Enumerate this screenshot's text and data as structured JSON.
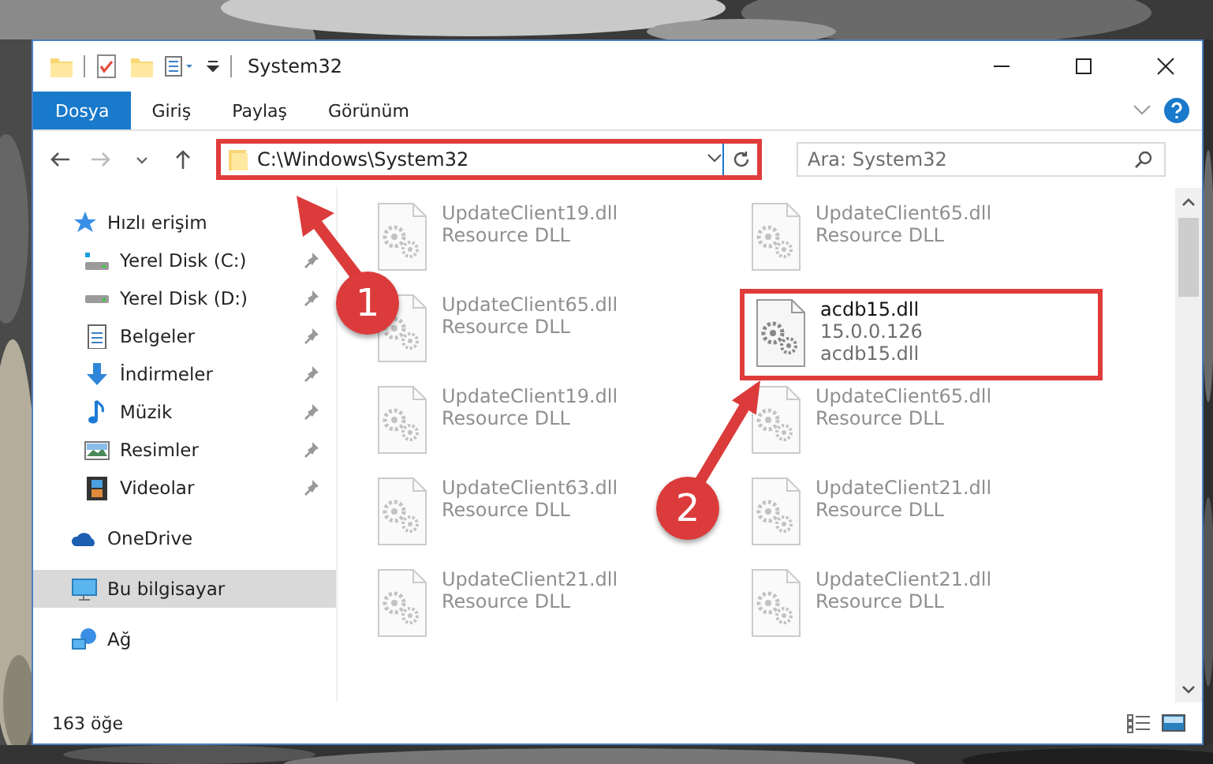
{
  "window": {
    "title": "System32"
  },
  "ribbon_tabs": [
    {
      "label": "Dosya",
      "kind": "file"
    },
    {
      "label": "Giriş",
      "kind": "tab"
    },
    {
      "label": "Paylaş",
      "kind": "tab"
    },
    {
      "label": "Görünüm",
      "kind": "tab"
    }
  ],
  "address_bar": {
    "path": "C:\\Windows\\System32",
    "highlighted": true
  },
  "search": {
    "placeholder": "Ara: System32"
  },
  "navigation": [
    {
      "label": "Hızlı erişim",
      "kind": "quick",
      "selected": false,
      "children": [
        {
          "label": "Yerel Disk (C:)",
          "kind": "disk-c",
          "pinned": true,
          "selected": false
        },
        {
          "label": "Yerel Disk (D:)",
          "kind": "disk",
          "pinned": true,
          "selected": false
        },
        {
          "label": "Belgeler",
          "kind": "documents",
          "pinned": true,
          "selected": false
        },
        {
          "label": "İndirmeler",
          "kind": "downloads",
          "pinned": true,
          "selected": false
        },
        {
          "label": "Müzik",
          "kind": "music",
          "pinned": true,
          "selected": false
        },
        {
          "label": "Resimler",
          "kind": "pictures",
          "pinned": true,
          "selected": false
        },
        {
          "label": "Videolar",
          "kind": "videos",
          "pinned": true,
          "selected": false
        }
      ]
    },
    {
      "label": "OneDrive",
      "kind": "cloud",
      "selected": false
    },
    {
      "label": "Bu bilgisayar",
      "kind": "computer",
      "selected": true
    },
    {
      "label": "Ağ",
      "kind": "network",
      "selected": false
    }
  ],
  "files": [
    {
      "name": "UpdateClient19.dll",
      "details": [
        "Resource DLL"
      ],
      "blurred": true,
      "highlighted": false
    },
    {
      "name": "UpdateClient65.dll",
      "details": [
        "Resource DLL"
      ],
      "blurred": true,
      "highlighted": false
    },
    {
      "name": "UpdateClient65.dll",
      "details": [
        "Resource DLL"
      ],
      "blurred": true,
      "highlighted": false
    },
    {
      "name": "acdb15.dll",
      "details": [
        "15.0.0.126",
        "acdb15.dll"
      ],
      "blurred": false,
      "highlighted": true
    },
    {
      "name": "UpdateClient19.dll",
      "details": [
        "Resource DLL"
      ],
      "blurred": true,
      "highlighted": false
    },
    {
      "name": "UpdateClient65.dll",
      "details": [
        "Resource DLL"
      ],
      "blurred": true,
      "highlighted": false
    },
    {
      "name": "UpdateClient63.dll",
      "details": [
        "Resource DLL"
      ],
      "blurred": true,
      "highlighted": false
    },
    {
      "name": "UpdateClient21.dll",
      "details": [
        "Resource DLL"
      ],
      "blurred": true,
      "highlighted": false
    },
    {
      "name": "UpdateClient21.dll",
      "details": [
        "Resource DLL"
      ],
      "blurred": true,
      "highlighted": false
    },
    {
      "name": "UpdateClient21.dll",
      "details": [
        "Resource DLL"
      ],
      "blurred": true,
      "highlighted": false
    }
  ],
  "status_bar": {
    "item_count": "163 öğe"
  },
  "callouts": [
    {
      "number": "1"
    },
    {
      "number": "2"
    }
  ]
}
